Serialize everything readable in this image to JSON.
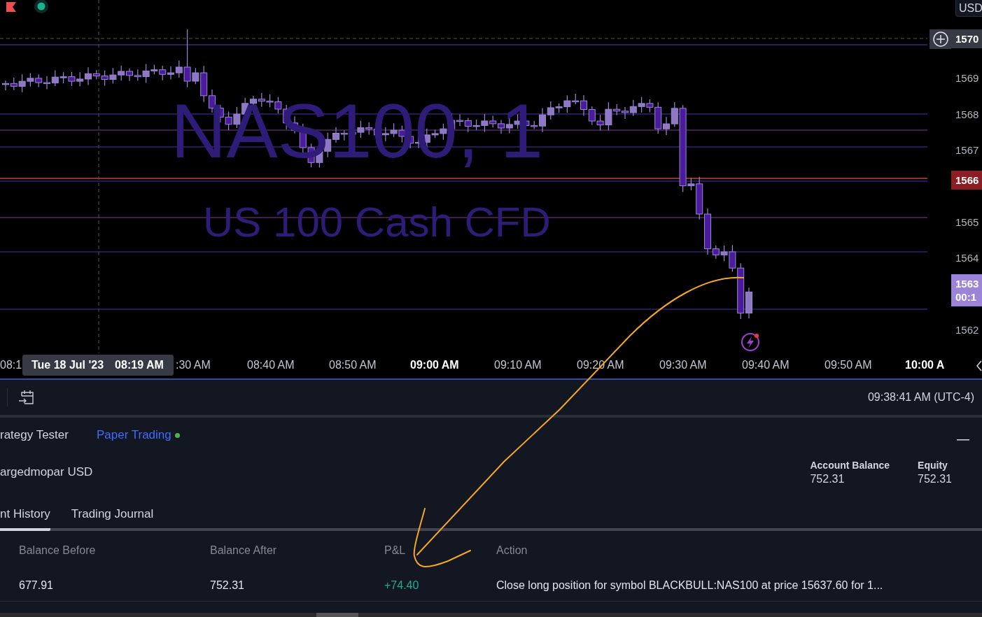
{
  "chart": {
    "watermark": {
      "symbol": "NAS100, 1",
      "description": "US 100 Cash CFD"
    },
    "currency": "USD",
    "price_labels": [
      {
        "kind": "crosshair",
        "lines": [
          "1570"
        ]
      },
      {
        "kind": "plain",
        "lines": [
          "1569"
        ]
      },
      {
        "kind": "plain",
        "lines": [
          "1568"
        ]
      },
      {
        "kind": "plain",
        "lines": [
          "1567"
        ]
      },
      {
        "kind": "last",
        "lines": [
          "1566"
        ]
      },
      {
        "kind": "plain",
        "lines": [
          "1565"
        ]
      },
      {
        "kind": "plain",
        "lines": [
          "1564"
        ]
      },
      {
        "kind": "countdown",
        "lines": [
          "1563",
          "00:1"
        ]
      },
      {
        "kind": "plain",
        "lines": [
          "1562"
        ]
      }
    ],
    "time_labels": [
      {
        "text": "08:1",
        "kind": "minute"
      },
      {
        "text": ":30 AM",
        "kind": "minute"
      },
      {
        "text": "08:40 AM",
        "kind": "minute"
      },
      {
        "text": "08:50 AM",
        "kind": "minute"
      },
      {
        "text": "09:00 AM",
        "kind": "hour"
      },
      {
        "text": "09:10 AM",
        "kind": "minute"
      },
      {
        "text": "09:20 AM",
        "kind": "minute"
      },
      {
        "text": "09:30 AM",
        "kind": "minute"
      },
      {
        "text": "09:40 AM",
        "kind": "minute"
      },
      {
        "text": "09:50 AM",
        "kind": "minute"
      },
      {
        "text": "10:00 A",
        "kind": "hour"
      }
    ],
    "crosshair_time": {
      "date": "Tue 18 Jul '23",
      "time": "08:19 AM"
    }
  },
  "toolbar": {
    "clock": "09:38:41 AM (UTC-4)"
  },
  "panel_tabs": [
    {
      "label": "rategy Tester",
      "selected": false
    },
    {
      "label": "Paper Trading",
      "selected": true
    }
  ],
  "account": {
    "name": "argedmopar USD",
    "stats": [
      {
        "label": "Account Balance",
        "value": "752.31"
      },
      {
        "label": "Equity",
        "value": "752.31"
      }
    ]
  },
  "sub_tabs": [
    {
      "label": "nt History",
      "selected": true
    },
    {
      "label": "Trading Journal",
      "selected": false
    }
  ],
  "table": {
    "columns": [
      "Balance Before",
      "Balance After",
      "P&L",
      "Action"
    ],
    "rows": [
      {
        "balance_before": "677.91",
        "balance_after": "752.31",
        "pnl": "+74.40",
        "profit": true,
        "action": "Close long position for symbol BLACKBULL:NAS100 at price 15637.60 for 1..."
      }
    ]
  }
}
